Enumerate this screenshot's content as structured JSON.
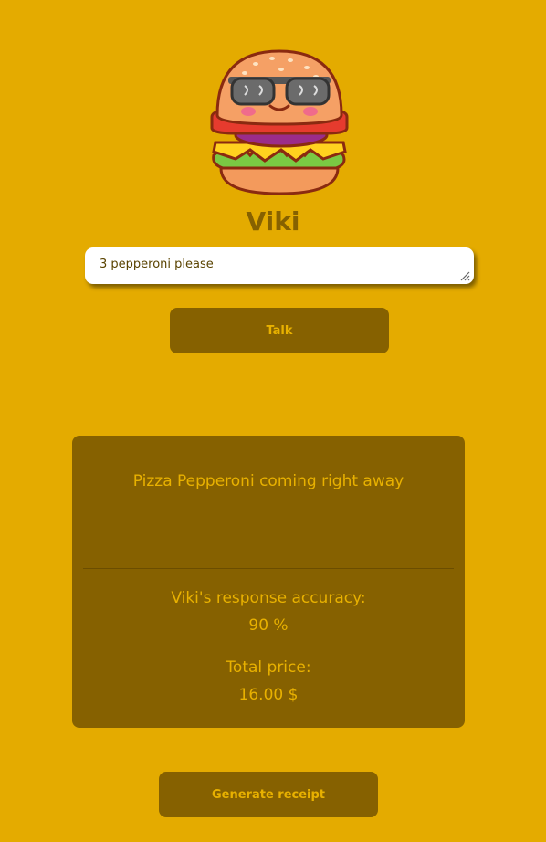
{
  "app": {
    "title": "Viki"
  },
  "chat": {
    "input_value": "3 pepperoni please",
    "talk_label": "Talk"
  },
  "response": {
    "message": "Pizza Pepperoni coming right away",
    "accuracy_label": "Viki's response accuracy:",
    "accuracy_value": "90 %",
    "price_label": "Total price:",
    "price_value": "16.00 $"
  },
  "actions": {
    "receipt_label": "Generate receipt"
  },
  "colors": {
    "background": "#e4ab00",
    "panel": "#866100",
    "accent_text": "#e8b100"
  },
  "icons": {
    "mascot": "burger-mascot-with-sunglasses-icon",
    "resize": "resize-grip-icon"
  }
}
